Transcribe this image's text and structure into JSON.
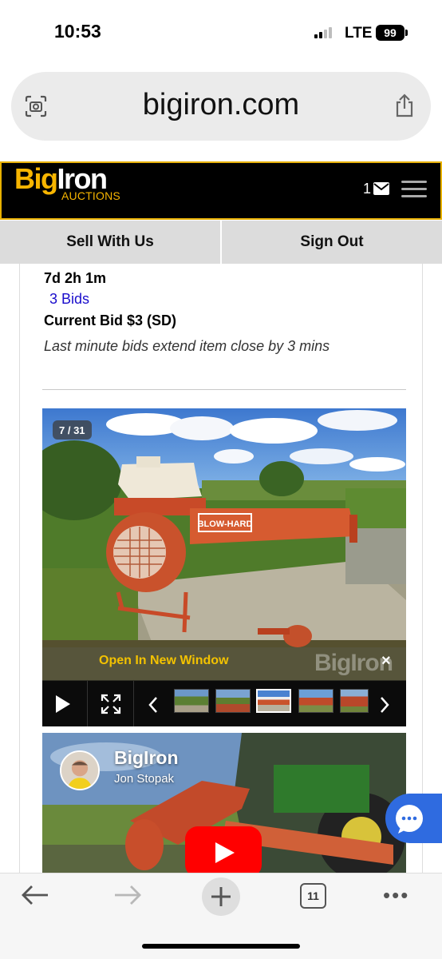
{
  "status_bar": {
    "time": "10:53",
    "network": "LTE",
    "battery": "99"
  },
  "browser": {
    "url": "bigiron.com",
    "tab_count": "11"
  },
  "site": {
    "logo_big": "Big",
    "logo_iron": "Iron",
    "logo_sub": "AUCTIONS",
    "cart_count": "1",
    "brand_color": "#f7b500"
  },
  "tabs": {
    "sell": "Sell With Us",
    "sign_out": "Sign Out"
  },
  "auction": {
    "time_left": "7d 2h 1m",
    "bids": "3 Bids",
    "current_bid": "Current Bid $3 (SD)",
    "extend_note": "Last minute bids extend item close by 3 mins"
  },
  "gallery": {
    "counter": "7 / 31",
    "open_new_window": "Open In New Window",
    "watermark": "BigIron",
    "close": "×",
    "equipment_label": "BLOW-HARD"
  },
  "video": {
    "channel": "BigIron",
    "presenter": "Jon Stopak"
  }
}
